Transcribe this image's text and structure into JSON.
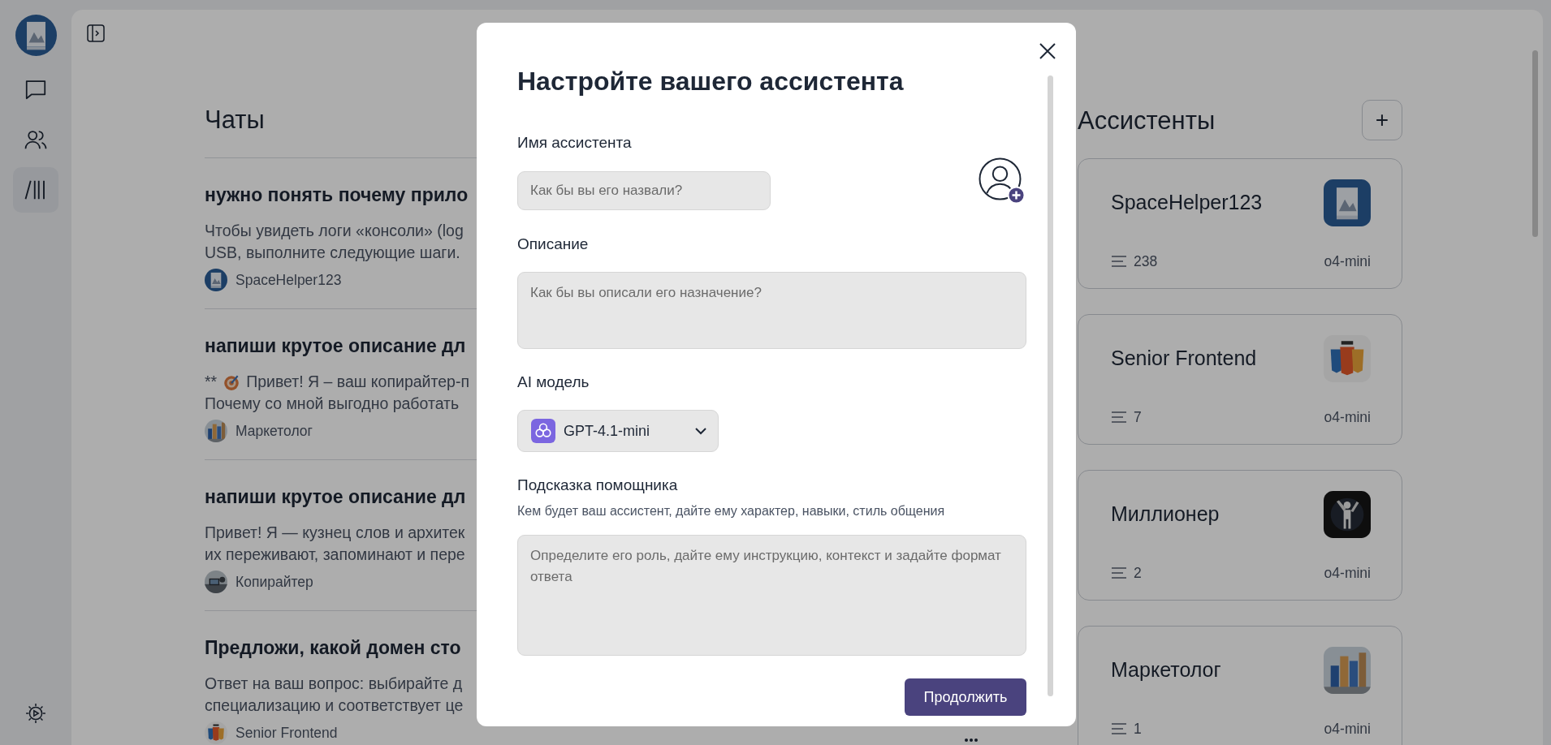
{
  "sidebar": {
    "items": [
      {
        "kind": "chat",
        "selected": false
      },
      {
        "kind": "people",
        "selected": false
      },
      {
        "kind": "library",
        "selected": true
      }
    ]
  },
  "chats": {
    "title": "Чаты",
    "items": [
      {
        "title": "нужно понять почему прило",
        "lines": [
          {
            "text": "Чтобы увидеть логи «консоли» (log"
          },
          {
            "text": "USB, выполните следующие шаги."
          }
        ],
        "author": "SpaceHelper123"
      },
      {
        "title": "напиши крутое описание дл",
        "lines": [
          {
            "prefix": "**",
            "emoji": true,
            "text": "Привет! Я – ваш копирайтер-п"
          },
          {
            "text": "Почему со мной выгодно работать"
          }
        ],
        "author": "Маркетолог"
      },
      {
        "title": "напиши крутое описание дл",
        "lines": [
          {
            "text": "Привет! Я — кузнец слов и архитек"
          },
          {
            "text": "их переживают, запоминают и пере"
          }
        ],
        "author": "Копирайтер"
      },
      {
        "title": "Предложи, какой домен сто",
        "lines": [
          {
            "text": "Ответ на ваш вопрос: выбирайте д"
          },
          {
            "text": "специализацию и соответствует це"
          }
        ],
        "author": "Senior Frontend",
        "menu": true
      }
    ]
  },
  "assistants": {
    "title": "Ассистенты",
    "add": "+",
    "items": [
      {
        "name": "SpaceHelper123",
        "count": "238",
        "model": "o4-mini"
      },
      {
        "name": "Senior Frontend",
        "count": "7",
        "model": "o4-mini"
      },
      {
        "name": "Миллионер",
        "count": "2",
        "model": "o4-mini"
      },
      {
        "name": "Маркетолог",
        "count": "1",
        "model": "o4-mini"
      }
    ]
  },
  "modal": {
    "title": "Настройте вашего ассистента",
    "name_label": "Имя ассистента",
    "name_placeholder": "Как бы вы его назвали?",
    "description_label": "Описание",
    "description_placeholder": "Как бы вы описали его назначение?",
    "model_label": "AI модель",
    "model_value": "GPT-4.1-mini",
    "prompt_label": "Подсказка помощника",
    "prompt_hint": "Кем будет ваш ассистент, дайте ему характер, навыки, стиль общения",
    "prompt_placeholder": "Определите его роль, дайте ему инструкцию, контекст и задайте формат ответа",
    "submit": "Продолжить"
  }
}
